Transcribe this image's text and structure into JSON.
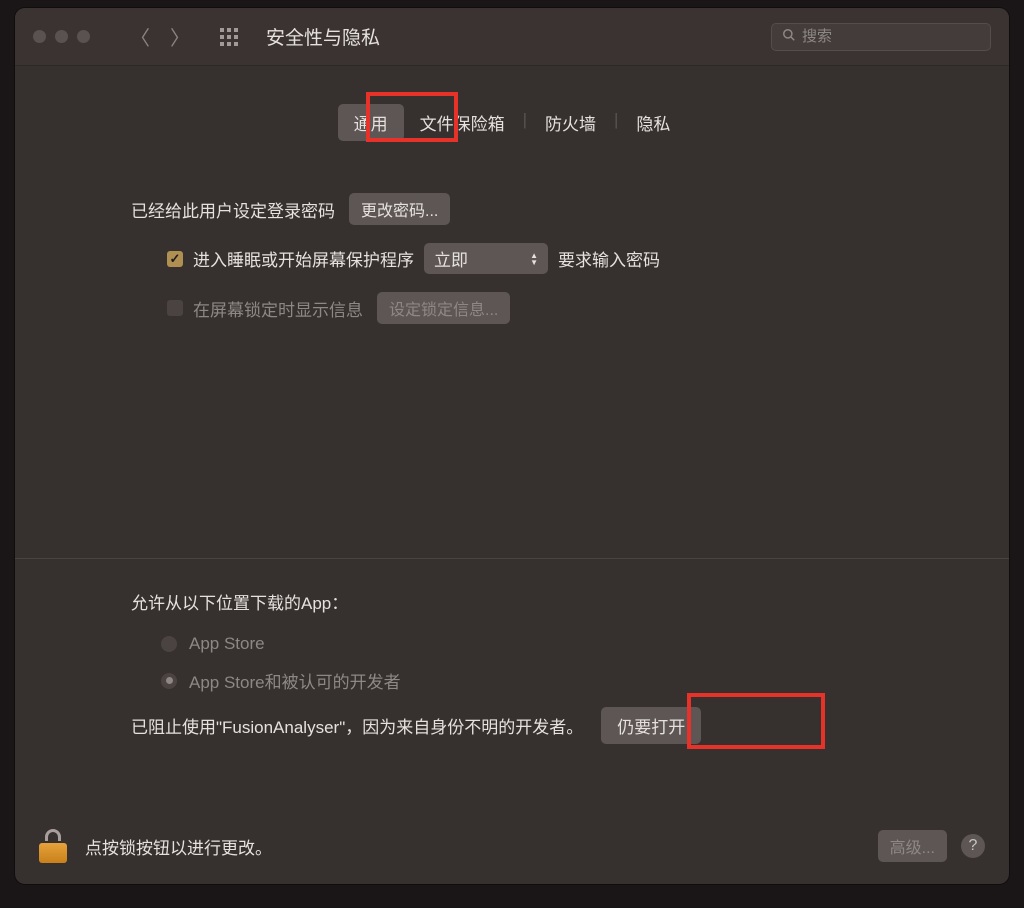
{
  "window": {
    "title": "安全性与隐私",
    "search_placeholder": "搜索"
  },
  "tabs": {
    "general": "通用",
    "filevault": "文件保险箱",
    "firewall": "防火墙",
    "privacy": "隐私"
  },
  "general": {
    "login_password_set": "已经给此用户设定登录密码",
    "change_password": "更改密码...",
    "require_password_prefix": "进入睡眠或开始屏幕保护程序",
    "require_password_delay": "立即",
    "require_password_suffix": "要求输入密码",
    "show_lock_message": "在屏幕锁定时显示信息",
    "set_lock_message": "设定锁定信息..."
  },
  "downloads": {
    "heading": "允许从以下位置下载的App：",
    "option_appstore": "App Store",
    "option_identified": "App Store和被认可的开发者",
    "blocked_text": "已阻止使用\"FusionAnalyser\"，因为来自身份不明的开发者。",
    "open_anyway": "仍要打开"
  },
  "footer": {
    "lock_hint": "点按锁按钮以进行更改。",
    "advanced": "高级..."
  }
}
